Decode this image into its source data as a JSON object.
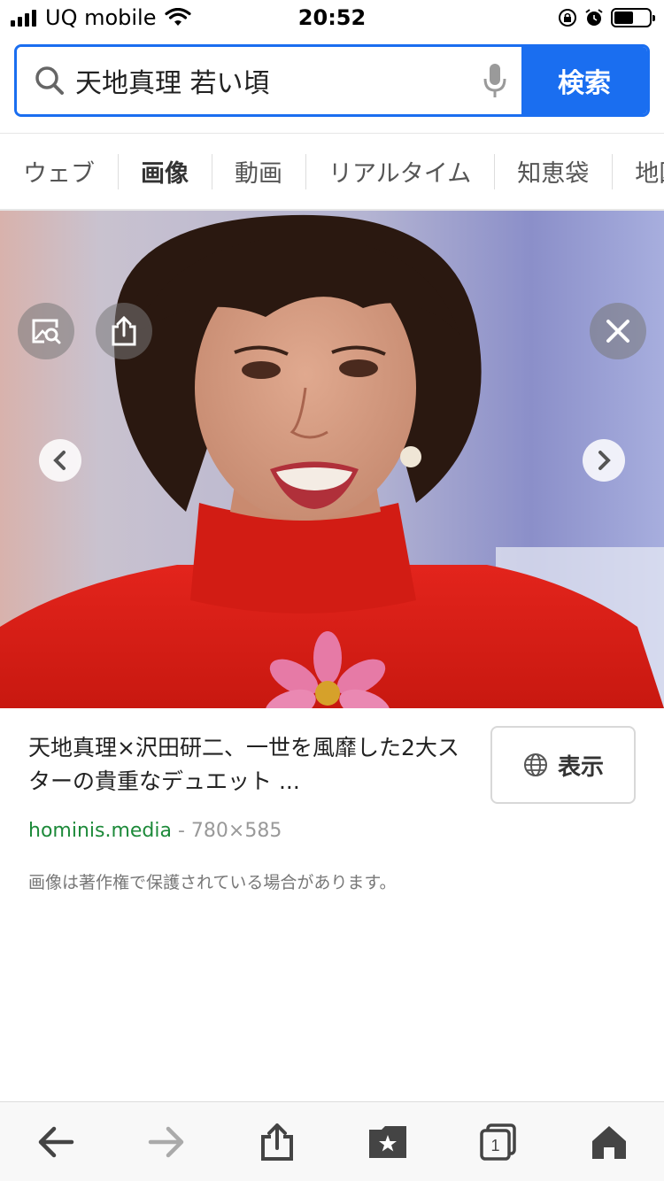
{
  "status_bar": {
    "carrier": "UQ mobile",
    "time": "20:52",
    "battery_level": 0.55
  },
  "search": {
    "query": "天地真理 若い頃",
    "button_label": "検索",
    "icons": [
      "search-icon",
      "mic-icon"
    ]
  },
  "tabs": [
    {
      "label": "ウェブ",
      "active": false
    },
    {
      "label": "画像",
      "active": true
    },
    {
      "label": "動画",
      "active": false
    },
    {
      "label": "リアルタイム",
      "active": false
    },
    {
      "label": "知恵袋",
      "active": false
    },
    {
      "label": "地図",
      "active": false
    }
  ],
  "viewer": {
    "controls": [
      "image-search-icon",
      "share-icon",
      "close-icon",
      "chevron-left-icon",
      "chevron-right-icon"
    ]
  },
  "result": {
    "title": "天地真理×沢田研二、一世を風靡した2大スターの貴重なデュエット ...",
    "show_button_label": "表示",
    "domain": "hominis.media",
    "separator": " - ",
    "dimensions": "780×585",
    "copyright_notice": "画像は著作権で保護されている場合があります。"
  },
  "toolbar": {
    "tab_count": "1",
    "icons": [
      "back-arrow-icon",
      "forward-arrow-icon",
      "share-icon",
      "bookmarks-icon",
      "tabs-icon",
      "home-icon"
    ]
  },
  "colors": {
    "accent": "#1a6ef0",
    "active_tab_underline": "#f06a6a",
    "domain_green": "#1d8a3a"
  }
}
